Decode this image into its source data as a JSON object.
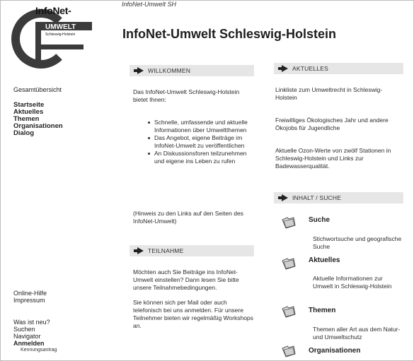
{
  "logo": {
    "line1": "InfoNet-",
    "line2": "UMWELT",
    "line3": "Schleswig-Holstein"
  },
  "header": {
    "kicker": "InfoNet-Umwelt SH",
    "title": "InfoNet-Umwelt Schleswig-Holstein"
  },
  "nav": {
    "overview": "Gesamtübersicht",
    "main": [
      "Startseite",
      "Aktuelles",
      "Themen",
      "Organisationen",
      "Dialog"
    ],
    "help": [
      "Online-Hilfe",
      "Impressum"
    ],
    "tools": [
      "Was ist neu?",
      "Suchen",
      "Navigator"
    ],
    "login": "Anmelden",
    "login_sub": "Kennungsantrag"
  },
  "willkommen": {
    "heading": "WILLKOMMEN",
    "intro": "Das InfoNet-Umwelt Schleswig-Holstein bietet Ihnen:",
    "bullets": [
      "Schnelle, umfassende und aktuelle Informationen über Umweltthemen",
      "Das Angebot, eigene Beiträge im InfoNet-Umwelt zu veröffentlichen",
      "An Diskussionsforen teilzunehmen und eigene ins Leben zu rufen"
    ],
    "note": "(Hinweis zu den Links auf den Seiten des InfoNet-Umwelt)"
  },
  "teilnahme": {
    "heading": "TEILNAHME",
    "p1": "Möchten auch Sie Beiträge ins InfoNet-Umwelt einstellen? Dann lesen Sie bitte unsere Teilnahmebedingungen.",
    "p2": "Sie können sich per Mail oder auch telefonisch bei uns anmelden. Für unsere Teilnehmer bieten wir regelmäßig Workshops an."
  },
  "aktuelles": {
    "heading": "AKTUELLES",
    "items": [
      "Linkliste zum Umweltrecht in Schleswig-Holstein",
      "Freiwilliges Ökologisches Jahr und andere Ökojobs für Jugendliche",
      "Aktuelle Ozon-Werte von zwölf Stationen in Schleswig-Holstein und Links zur Badewasserqualität."
    ]
  },
  "inhalt": {
    "heading": "INHALT / SUCHE",
    "items": [
      {
        "title": "Suche",
        "desc": "Stichwortsuche und geografische Suche"
      },
      {
        "title": "Aktuelles",
        "desc": "Aktuelle Informationen zur Umwelt in Schleswig-Holstein"
      },
      {
        "title": "Themen",
        "desc": "Themen aller Art aus dem Natur- und Umweltschutz"
      },
      {
        "title": "Organisationen",
        "desc": ""
      }
    ]
  },
  "icons": {
    "section_marker": "arrow-right-icon",
    "content_item": "folder-icon"
  }
}
